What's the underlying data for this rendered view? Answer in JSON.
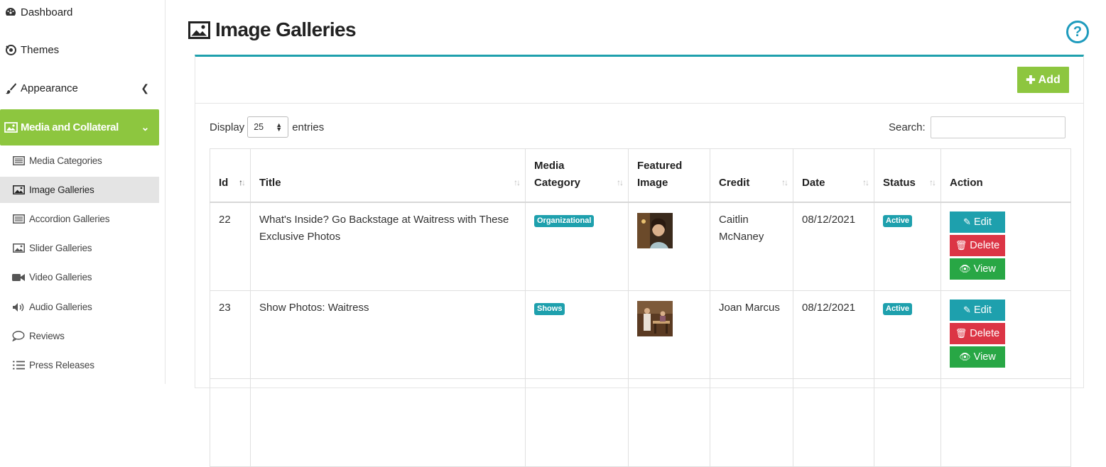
{
  "sidebar": {
    "main": [
      {
        "label": "Dashboard",
        "icon": "dashboard-icon"
      },
      {
        "label": "Themes",
        "icon": "themes-icon"
      },
      {
        "label": "Appearance",
        "icon": "paint-brush-icon"
      },
      {
        "label": "Media and Collateral",
        "icon": "image-icon"
      }
    ],
    "sub": [
      {
        "label": "Media Categories",
        "icon": "list-alt-icon"
      },
      {
        "label": "Image Galleries",
        "icon": "image-icon"
      },
      {
        "label": "Accordion Galleries",
        "icon": "list-alt-icon"
      },
      {
        "label": "Slider Galleries",
        "icon": "image-icon"
      },
      {
        "label": "Video Galleries",
        "icon": "video-camera-icon"
      },
      {
        "label": "Audio Galleries",
        "icon": "volume-icon"
      },
      {
        "label": "Reviews",
        "icon": "comment-icon"
      },
      {
        "label": "Press Releases",
        "icon": "list-icon"
      }
    ],
    "accent_color": "#8dc63f"
  },
  "header": {
    "title": "Image Galleries",
    "help": "?"
  },
  "toolbar": {
    "add_label": "Add"
  },
  "listing": {
    "display_label": "Display",
    "page_size": "25",
    "entries_label": "entries",
    "search_label": "Search:"
  },
  "table": {
    "columns": [
      "Id",
      "Title",
      "Media Category",
      "Featured Image",
      "Credit",
      "Date",
      "Status",
      "Action"
    ],
    "rows": [
      {
        "id": "22",
        "title": "What's Inside? Go Backstage at Waitress with These Exclusive Photos",
        "category": "Organizational",
        "credit": "Caitlin McNaney",
        "date": "08/12/2021",
        "status": "Active"
      },
      {
        "id": "23",
        "title": "Show Photos: Waitress",
        "category": "Shows",
        "credit": "Joan Marcus",
        "date": "08/12/2021",
        "status": "Active"
      }
    ],
    "actions": {
      "edit": "Edit",
      "delete": "Delete",
      "view": "View"
    }
  },
  "colors": {
    "teal": "#1ea0ad",
    "green": "#28a745",
    "red": "#dc3545",
    "lime": "#8dc63f"
  }
}
